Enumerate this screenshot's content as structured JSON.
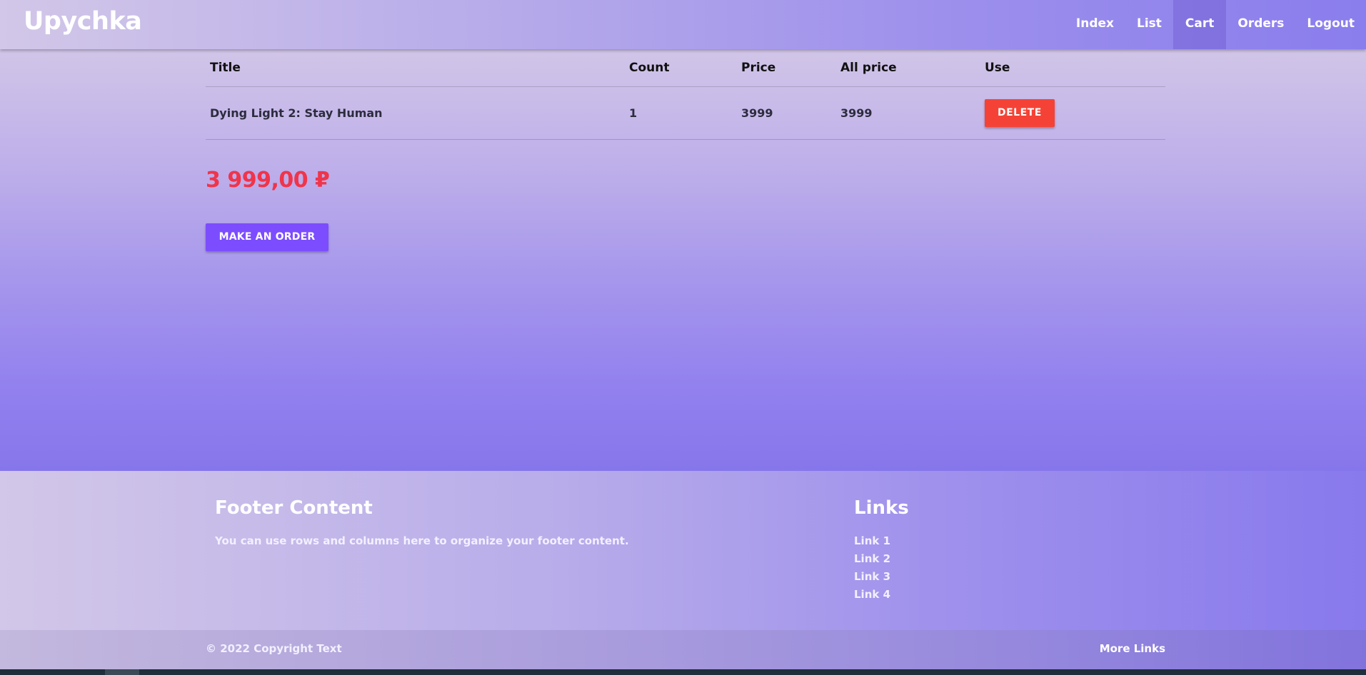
{
  "navbar": {
    "brand": "Upychka",
    "links": [
      {
        "label": "Index"
      },
      {
        "label": "List"
      },
      {
        "label": "Cart",
        "active": true
      },
      {
        "label": "Orders"
      },
      {
        "label": "Logout"
      }
    ]
  },
  "cart": {
    "headers": {
      "title": "Title",
      "count": "Count",
      "price": "Price",
      "all_price": "All price",
      "use": "Use"
    },
    "rows": [
      {
        "title": "Dying Light 2: Stay Human",
        "count": "1",
        "price": "3999",
        "all_price": "3999",
        "action_label": "DELETE"
      }
    ],
    "total": "3 999,00 ₽",
    "order_button": "MAKE AN ORDER"
  },
  "footer": {
    "content_title": "Footer Content",
    "content_text": "You can use rows and columns here to organize your footer content.",
    "links_title": "Links",
    "links": [
      "Link 1",
      "Link 2",
      "Link 3",
      "Link 4"
    ],
    "copyright": "© 2022 Copyright Text",
    "more_links": "More Links"
  },
  "colors": {
    "accent": "#7c4dff",
    "danger": "#f44336",
    "total": "#f0344a"
  }
}
